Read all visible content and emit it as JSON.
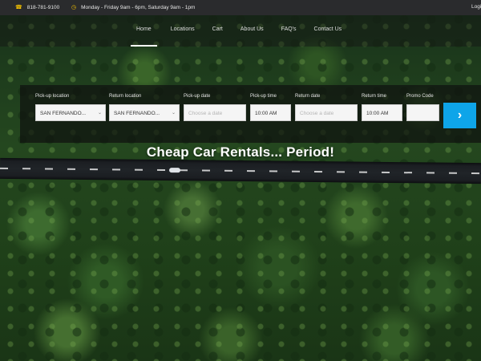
{
  "topbar": {
    "phone_icon": "phone-icon",
    "phone": "818-781-9100",
    "clock_icon": "clock-icon",
    "hours": "Monday - Friday 9am - 6pm, Saturday 9am - 1pm",
    "login": "Login"
  },
  "nav": {
    "items": [
      {
        "label": "Home"
      },
      {
        "label": "Locations"
      },
      {
        "label": "Cart"
      },
      {
        "label": "About Us"
      },
      {
        "label": "FAQ's"
      },
      {
        "label": "Contact Us"
      }
    ]
  },
  "form": {
    "pickup_location": {
      "label": "Pick-up location",
      "value": "SAN FERNANDO..."
    },
    "return_location": {
      "label": "Return location",
      "value": "SAN FERNANDO..."
    },
    "pickup_date": {
      "label": "Pick-up date",
      "placeholder": "Choose a date"
    },
    "pickup_time": {
      "label": "Pick-up time",
      "value": "10:00 AM"
    },
    "return_date": {
      "label": "Return date",
      "placeholder": "Choose a date"
    },
    "return_time": {
      "label": "Return time",
      "value": "10:00 AM"
    },
    "promo_code": {
      "label": "Promo Code",
      "value": ""
    },
    "search_icon": "chevron-right-icon"
  },
  "hero": {
    "headline": "Cheap Car Rentals... Period!"
  },
  "colors": {
    "accent": "#0ea5e9",
    "topbar_icon": "#f2c000",
    "topbar_bg": "#2a2b2d"
  }
}
